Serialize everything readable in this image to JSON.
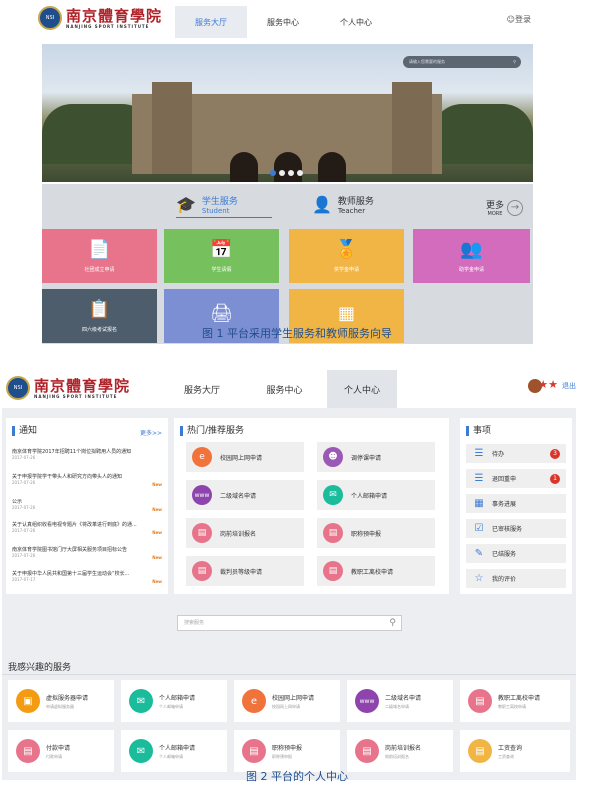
{
  "fig1": {
    "logo": {
      "cn": "南京體育學院",
      "en": "NANJING SPORT INSTITUTE",
      "seal": "南京體育學院"
    },
    "nav": [
      "服务大厅",
      "服务中心",
      "个人中心"
    ],
    "login": "登录",
    "search_placeholder": "请输入您需要的服务",
    "tabs": [
      {
        "title": "学生服务",
        "sub": "Student"
      },
      {
        "title": "教师服务",
        "sub": "Teacher"
      }
    ],
    "more": {
      "title": "更多",
      "sub": "MORE"
    },
    "tiles": [
      {
        "label": "社团成立申请",
        "icon": "document-icon",
        "color": "#e8748c"
      },
      {
        "label": "学生请假",
        "icon": "calendar-icon",
        "color": "#76c15d"
      },
      {
        "label": "奖学金申请",
        "icon": "medal-icon",
        "color": "#f1b545"
      },
      {
        "label": "助学金申请",
        "icon": "add-user-icon",
        "color": "#d46cbd"
      },
      {
        "label": "四六级考试报名",
        "icon": "clipboard-icon",
        "color": "#4e5d6c"
      },
      {
        "label": "",
        "icon": "printer-icon",
        "color": "#7d8fd3"
      },
      {
        "label": "",
        "icon": "table-icon",
        "color": "#f1b545"
      }
    ],
    "caption": "图 1 平台采用学生服务和教师服务向导"
  },
  "fig2": {
    "logo": {
      "cn": "南京體育學院",
      "en": "NANJING SPORT INSTITUTE"
    },
    "nav": [
      "服务大厅",
      "服务中心",
      "个人中心"
    ],
    "logout": "退出",
    "notice": {
      "title": "通知",
      "more": "更多>>",
      "items": [
        {
          "text": "南京体育学院2017年招聘11个岗位拟聘用人员的通知",
          "date": "2017-07-26",
          "new": ""
        },
        {
          "text": "关于申报学院学干带头人和研究方向带头人的通知",
          "date": "2017-07-26",
          "new": "New"
        },
        {
          "text": "公示",
          "date": "2017-07-26",
          "new": "New"
        },
        {
          "text": "关于认真组织收看电视专题片《将改革进行到底》的通...",
          "date": "2017-07-26",
          "new": "New"
        },
        {
          "text": "南京体育学院图书馆门厅大屏相关服务项目招标公告",
          "date": "2017-07-26",
          "new": "New"
        },
        {
          "text": "关于申报中华人民共和国第十三届学生运动会“校长...",
          "date": "2017-07-17",
          "new": "New"
        }
      ]
    },
    "hot": {
      "title": "热门/推荐服务",
      "items": [
        {
          "label": "校园网上网申请",
          "icon": "ie-icon",
          "color": "#f0733c"
        },
        {
          "label": "调停课申请",
          "icon": "person-icon",
          "color": "#9b59b6"
        },
        {
          "label": "二级域名申请",
          "icon": "www-icon",
          "color": "#8e44ad"
        },
        {
          "label": "个人邮箱申请",
          "icon": "mail-icon",
          "color": "#1abc9c"
        },
        {
          "label": "岗前培训报名",
          "icon": "document-icon",
          "color": "#e8748c"
        },
        {
          "label": "职称预申报",
          "icon": "document-icon",
          "color": "#e8748c"
        },
        {
          "label": "裁判员等级申请",
          "icon": "document-icon",
          "color": "#e8748c"
        },
        {
          "label": "教职工离校申请",
          "icon": "document-icon",
          "color": "#e8748c"
        }
      ]
    },
    "tasks": {
      "title": "事项",
      "items": [
        {
          "label": "待办",
          "icon": "list-icon",
          "count": "3"
        },
        {
          "label": "退回重申",
          "icon": "list-icon",
          "count": "1"
        },
        {
          "label": "事务进展",
          "icon": "grid-icon",
          "count": ""
        },
        {
          "label": "已审核服务",
          "icon": "check-doc-icon",
          "count": ""
        },
        {
          "label": "已结服务",
          "icon": "edit-icon",
          "count": ""
        },
        {
          "label": "我的评价",
          "icon": "star-icon",
          "count": ""
        }
      ]
    },
    "search_placeholder": "搜索服务",
    "interest": {
      "title": "我感兴趣的服务",
      "items": [
        {
          "title": "虚拟服务器申请",
          "sub": "申请虚拟服务器",
          "icon": "monitor-icon",
          "color": "#f39c12"
        },
        {
          "title": "个人邮箱申请",
          "sub": "个人邮箱申请",
          "icon": "mail-icon",
          "color": "#1abc9c"
        },
        {
          "title": "校园网上网申请",
          "sub": "校园网上网申请",
          "icon": "ie-icon",
          "color": "#f0733c"
        },
        {
          "title": "二级域名申请",
          "sub": "二级域名申请",
          "icon": "www-icon",
          "color": "#8e44ad"
        },
        {
          "title": "教职工离校申请",
          "sub": "教职工离校申请",
          "icon": "document-icon",
          "color": "#e8748c"
        },
        {
          "title": "付款申请",
          "sub": "付款申请",
          "icon": "document-icon",
          "color": "#e8748c"
        },
        {
          "title": "个人邮箱申请",
          "sub": "个人邮箱申请",
          "icon": "mail-icon",
          "color": "#1abc9c"
        },
        {
          "title": "职称预申报",
          "sub": "职称预申报",
          "icon": "document-icon",
          "color": "#e8748c"
        },
        {
          "title": "岗前培训报名",
          "sub": "岗前培训报名",
          "icon": "document-icon",
          "color": "#e8748c"
        },
        {
          "title": "工资查询",
          "sub": "工资查询",
          "icon": "card-icon",
          "color": "#f1b545"
        }
      ]
    },
    "caption": "图 2 平台的个人中心"
  }
}
